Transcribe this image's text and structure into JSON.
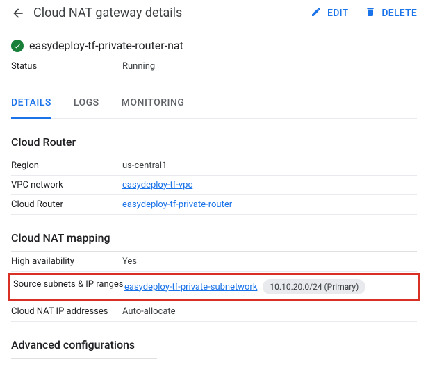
{
  "header": {
    "title": "Cloud NAT gateway details",
    "edit_label": "EDIT",
    "delete_label": "DELETE"
  },
  "resource": {
    "name": "easydeploy-tf-private-router-nat",
    "status_label": "Status",
    "status_value": "Running"
  },
  "tabs": [
    {
      "label": "DETAILS",
      "active": true
    },
    {
      "label": "LOGS",
      "active": false
    },
    {
      "label": "MONITORING",
      "active": false
    }
  ],
  "sections": {
    "cloud_router": {
      "title": "Cloud Router",
      "region_label": "Region",
      "region_value": "us-central1",
      "vpc_label": "VPC network",
      "vpc_value": "easydeploy-tf-vpc",
      "router_label": "Cloud Router",
      "router_value": "easydeploy-tf-private-router"
    },
    "nat_mapping": {
      "title": "Cloud NAT mapping",
      "ha_label": "High availability",
      "ha_value": "Yes",
      "subnets_label": "Source subnets & IP ranges",
      "subnets_link": "easydeploy-tf-private-subnetwork",
      "subnets_chip": "10.10.20.0/24 (Primary)",
      "ips_label": "Cloud NAT IP addresses",
      "ips_value": "Auto-allocate"
    },
    "advanced": {
      "title": "Advanced configurations"
    }
  }
}
